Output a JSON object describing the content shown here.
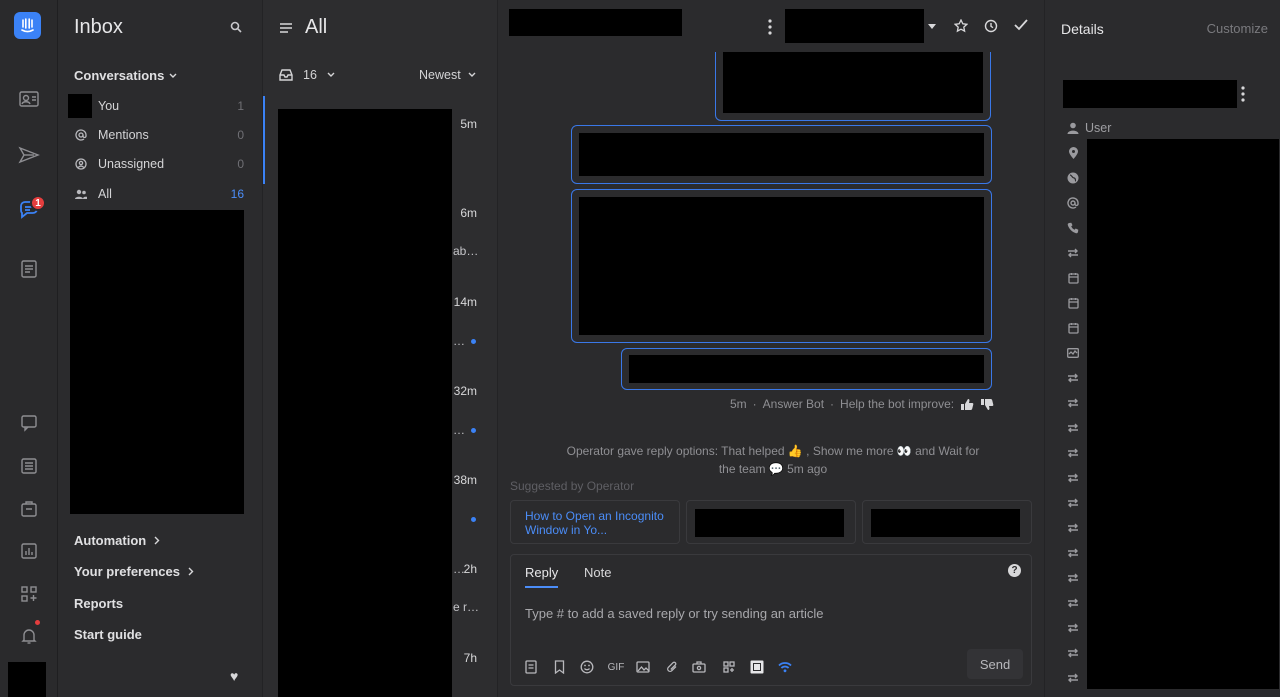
{
  "rail": {
    "badge_count": "1",
    "icons": [
      "logo-icon",
      "contacts-icon",
      "outbound-icon",
      "inbox-chat-icon",
      "articles-icon",
      "messages-icon",
      "feed-icon",
      "inbox-tray-icon",
      "reports-icon",
      "apps-icon",
      "notifications-icon"
    ]
  },
  "inbox_sidebar": {
    "title": "Inbox",
    "section": "Conversations",
    "items": [
      {
        "label": "You",
        "count": "1"
      },
      {
        "label": "Mentions",
        "count": "0"
      },
      {
        "label": "Unassigned",
        "count": "0"
      },
      {
        "label": "All",
        "count": "16"
      }
    ],
    "links": [
      {
        "label": "Automation"
      },
      {
        "label": "Your preferences"
      },
      {
        "label": "Reports"
      },
      {
        "label": "Start guide"
      }
    ]
  },
  "list": {
    "title": "All",
    "count": "16",
    "sort": "Newest",
    "items": [
      {
        "time": "5m",
        "snippet": "",
        "unread": false
      },
      {
        "time": "6m",
        "snippet": "ab…",
        "unread": false
      },
      {
        "time": "14m",
        "snippet": "…",
        "unread": true
      },
      {
        "time": "32m",
        "snippet": "…",
        "unread": true
      },
      {
        "time": "38m",
        "snippet": "",
        "unread": true
      },
      {
        "time": "2h",
        "snippet": "…",
        "unread": false
      },
      {
        "time": "",
        "snippet": "e r…",
        "unread": false
      },
      {
        "time": "7h",
        "snippet": "",
        "unread": false
      }
    ]
  },
  "conversation": {
    "bot_meta": {
      "time": "5m",
      "author": "Answer Bot",
      "help_text": "Help the bot improve:"
    },
    "operator_note": "Operator gave reply options: That helped 👍 , Show me more 👀  and Wait for the team 💬  5m ago",
    "suggested_label": "Suggested by Operator",
    "suggestions": [
      {
        "title": "How to Open an Incognito Window in Yo..."
      }
    ],
    "composer": {
      "tabs": [
        "Reply",
        "Note"
      ],
      "active_tab": "Reply",
      "placeholder": "Type # to add a saved reply or try sending an article",
      "gif_label": "GIF",
      "send_label": "Send"
    }
  },
  "details": {
    "title": "Details",
    "customize": "Customize",
    "user_label": "User"
  },
  "colors": {
    "accent": "#3b82f6",
    "badge": "#e53e3e",
    "background": "#2b2b2d"
  }
}
